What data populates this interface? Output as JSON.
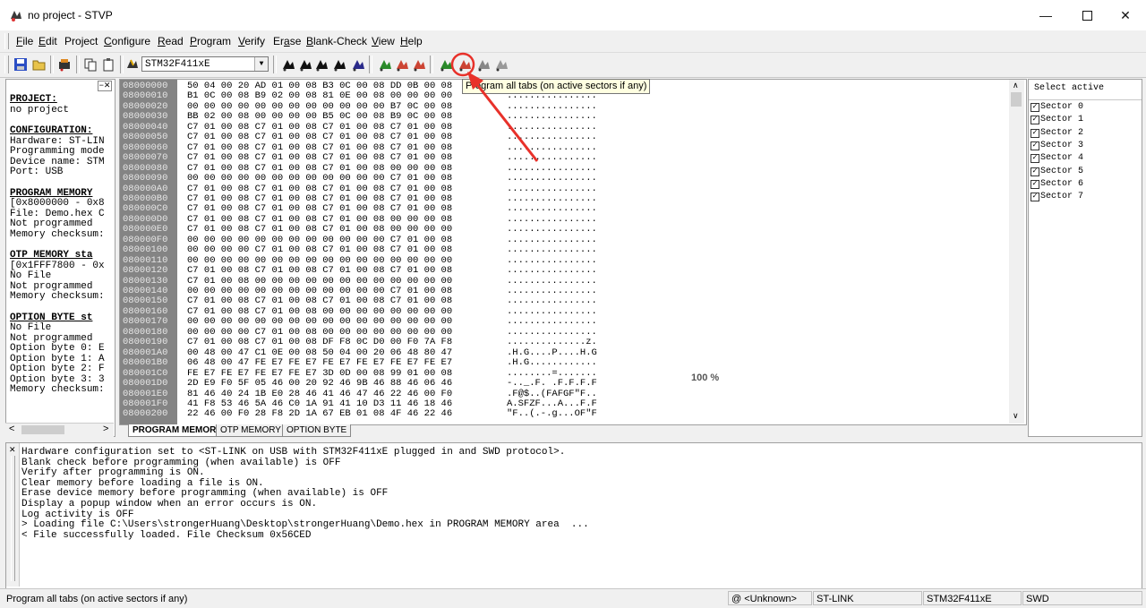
{
  "window": {
    "title": "no project - STVP"
  },
  "menu": [
    "File",
    "Edit",
    "Project",
    "Configure",
    "Read",
    "Program",
    "Verify",
    "Erase",
    "Blank-Check",
    "View",
    "Help"
  ],
  "menu_underline": [
    "F",
    "E",
    "j",
    "C",
    "R",
    "P",
    "V",
    "a",
    "B",
    "V",
    "H"
  ],
  "toolbar": {
    "device": "STM32F411xE"
  },
  "tooltip": "Program all tabs (on active sectors if any)",
  "left_panel": {
    "sections": [
      {
        "heading": "PROJECT:",
        "lines": [
          "no project"
        ]
      },
      {
        "heading": "CONFIGURATION:",
        "lines": [
          "Hardware: ST-LIN",
          "Programming mode",
          "Device name: STM",
          "Port: USB"
        ]
      },
      {
        "heading": "PROGRAM MEMORY",
        "lines": [
          "[0x8000000 - 0x8",
          "File: Demo.hex C",
          "Not programmed",
          "Memory checksum:"
        ]
      },
      {
        "heading": "OTP MEMORY sta",
        "lines": [
          "[0x1FFF7800 - 0x",
          "No File",
          "Not programmed",
          "Memory checksum:"
        ]
      },
      {
        "heading": "OPTION BYTE st",
        "lines": [
          "No File",
          "Not programmed",
          "Option byte 0: E",
          "Option byte 1: A",
          "Option byte 2: F",
          "Option byte 3: 3",
          "Memory checksum:"
        ]
      }
    ]
  },
  "memory": {
    "rows": [
      {
        "addr": "08000000",
        "hex": "50 04 00 20 AD 01 00 08 B3 0C 00 08 DD 0B 00 08",
        "ascii": "P.........."
      },
      {
        "addr": "08000010",
        "hex": "B1 0C 00 08 B9 02 00 08 81 0E 00 08 00 00 00 00",
        "ascii": "................"
      },
      {
        "addr": "08000020",
        "hex": "00 00 00 00 00 00 00 00 00 00 00 00 B7 0C 00 08",
        "ascii": "................"
      },
      {
        "addr": "08000030",
        "hex": "BB 02 00 08 00 00 00 00 B5 0C 00 08 B9 0C 00 08",
        "ascii": "................"
      },
      {
        "addr": "08000040",
        "hex": "C7 01 00 08 C7 01 00 08 C7 01 00 08 C7 01 00 08",
        "ascii": "................"
      },
      {
        "addr": "08000050",
        "hex": "C7 01 00 08 C7 01 00 08 C7 01 00 08 C7 01 00 08",
        "ascii": "................"
      },
      {
        "addr": "08000060",
        "hex": "C7 01 00 08 C7 01 00 08 C7 01 00 08 C7 01 00 08",
        "ascii": "................"
      },
      {
        "addr": "08000070",
        "hex": "C7 01 00 08 C7 01 00 08 C7 01 00 08 C7 01 00 08",
        "ascii": "................"
      },
      {
        "addr": "08000080",
        "hex": "C7 01 00 08 C7 01 00 08 C7 01 00 08 00 00 00 08",
        "ascii": "................"
      },
      {
        "addr": "08000090",
        "hex": "00 00 00 00 00 00 00 00 00 00 00 00 C7 01 00 08",
        "ascii": "................"
      },
      {
        "addr": "080000A0",
        "hex": "C7 01 00 08 C7 01 00 08 C7 01 00 08 C7 01 00 08",
        "ascii": "................"
      },
      {
        "addr": "080000B0",
        "hex": "C7 01 00 08 C7 01 00 08 C7 01 00 08 C7 01 00 08",
        "ascii": "................"
      },
      {
        "addr": "080000C0",
        "hex": "C7 01 00 08 C7 01 00 08 C7 01 00 08 C7 01 00 08",
        "ascii": "................"
      },
      {
        "addr": "080000D0",
        "hex": "C7 01 00 08 C7 01 00 08 C7 01 00 08 00 00 00 08",
        "ascii": "................"
      },
      {
        "addr": "080000E0",
        "hex": "C7 01 00 08 C7 01 00 08 C7 01 00 08 00 00 00 00",
        "ascii": "................"
      },
      {
        "addr": "080000F0",
        "hex": "00 00 00 00 00 00 00 00 00 00 00 00 C7 01 00 08",
        "ascii": "................"
      },
      {
        "addr": "08000100",
        "hex": "00 00 00 00 C7 01 00 08 C7 01 00 08 C7 01 00 08",
        "ascii": "................"
      },
      {
        "addr": "08000110",
        "hex": "00 00 00 00 00 00 00 00 00 00 00 00 00 00 00 00",
        "ascii": "................"
      },
      {
        "addr": "08000120",
        "hex": "C7 01 00 08 C7 01 00 08 C7 01 00 08 C7 01 00 08",
        "ascii": "................"
      },
      {
        "addr": "08000130",
        "hex": "C7 01 00 08 00 00 00 00 00 00 00 00 00 00 00 00",
        "ascii": "................"
      },
      {
        "addr": "08000140",
        "hex": "00 00 00 00 00 00 00 00 00 00 00 00 C7 01 00 08",
        "ascii": "................"
      },
      {
        "addr": "08000150",
        "hex": "C7 01 00 08 C7 01 00 08 C7 01 00 08 C7 01 00 08",
        "ascii": "................"
      },
      {
        "addr": "08000160",
        "hex": "C7 01 00 08 C7 01 00 08 00 00 00 00 00 00 00 00",
        "ascii": "................"
      },
      {
        "addr": "08000170",
        "hex": "00 00 00 00 00 00 00 00 00 00 00 00 00 00 00 00",
        "ascii": "................"
      },
      {
        "addr": "08000180",
        "hex": "00 00 00 00 C7 01 00 08 00 00 00 00 00 00 00 00",
        "ascii": "................"
      },
      {
        "addr": "08000190",
        "hex": "C7 01 00 08 C7 01 00 08 DF F8 0C D0 00 F0 7A F8",
        "ascii": "..............z."
      },
      {
        "addr": "080001A0",
        "hex": "00 48 00 47 C1 0E 00 08 50 04 00 20 06 48 80 47",
        "ascii": ".H.G....P....H.G"
      },
      {
        "addr": "080001B0",
        "hex": "06 48 00 47 FE E7 FE E7 FE E7 FE E7 FE E7 FE E7",
        "ascii": ".H.G............"
      },
      {
        "addr": "080001C0",
        "hex": "FE E7 FE E7 FE E7 FE E7 3D 0D 00 08 99 01 00 08",
        "ascii": "........=......."
      },
      {
        "addr": "080001D0",
        "hex": "2D E9 F0 5F 05 46 00 20 92 46 9B 46 88 46 06 46",
        "ascii": "-.._.F. .F.F.F.F"
      },
      {
        "addr": "080001E0",
        "hex": "81 46 40 24 1B E0 28 46 41 46 47 46 22 46 00 F0",
        "ascii": ".F@$..(FAFGF\"F.."
      },
      {
        "addr": "080001F0",
        "hex": "41 F8 53 46 5A 46 C0 1A 91 41 10 D3 11 46 18 46",
        "ascii": "A.SFZF...A...F.F"
      },
      {
        "addr": "08000200",
        "hex": "22 46 00 F0 28 F8 2D 1A 67 EB 01 08 4F 46 22 46",
        "ascii": "\"F..(.-.g...OF\"F"
      }
    ],
    "progress": "100 %"
  },
  "tabs": [
    "PROGRAM MEMORY",
    "OTP MEMORY",
    "OPTION BYTE"
  ],
  "right_panel": {
    "title": "Select active",
    "sectors": [
      "Sector 0",
      "Sector 1",
      "Sector 2",
      "Sector 3",
      "Sector 4",
      "Sector 5",
      "Sector 6",
      "Sector 7"
    ]
  },
  "log": [
    "Hardware configuration set to <ST-LINK on USB with STM32F411xE plugged in and SWD protocol>.",
    "Blank check before programming (when available) is OFF",
    "Verify after programming is ON.",
    "Clear memory before loading a file is ON.",
    "Erase device memory before programming (when available) is OFF",
    "Display a popup window when an error occurs is ON.",
    "Log activity is OFF",
    "> Loading file C:\\Users\\strongerHuang\\Desktop\\strongerHuang\\Demo.hex in PROGRAM MEMORY area  ...",
    "< File successfully loaded. File Checksum 0x56CED"
  ],
  "statusbar": {
    "message": "Program all tabs (on active sectors if any)",
    "address": "@ <Unknown>",
    "tool": "ST-LINK",
    "device": "STM32F411xE",
    "protocol": "SWD"
  },
  "colors": {
    "annotation": "#e8312a",
    "address_bg": "#848484",
    "tooltip_bg": "#ffffe1"
  }
}
